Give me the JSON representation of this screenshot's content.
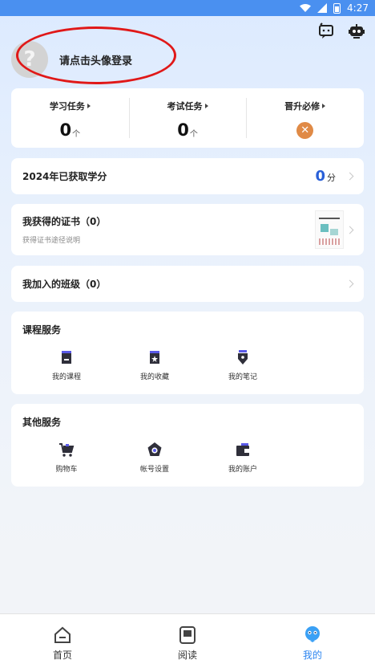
{
  "status_bar": {
    "time": "4:27"
  },
  "header": {
    "icons": [
      "chat-bubble-icon",
      "robot-icon"
    ]
  },
  "profile": {
    "avatar_glyph": "?",
    "login_prompt": "请点击头像登录"
  },
  "tasks": [
    {
      "title": "学习任务",
      "count": "0",
      "unit": "个"
    },
    {
      "title": "考试任务",
      "count": "0",
      "unit": "个"
    },
    {
      "title": "晋升必修",
      "status_glyph": "✕"
    }
  ],
  "credits": {
    "title": "2024年已获取学分",
    "value": "0",
    "unit": "分"
  },
  "certificates": {
    "title": "我获得的证书（0）",
    "subtitle": "获得证书途径说明"
  },
  "classes": {
    "title": "我加入的班级（0）"
  },
  "course_services": {
    "title": "课程服务",
    "items": [
      {
        "label": "我的课程",
        "icon": "course-book-icon"
      },
      {
        "label": "我的收藏",
        "icon": "favorites-star-icon"
      },
      {
        "label": "我的笔记",
        "icon": "notes-pen-icon"
      }
    ]
  },
  "other_services": {
    "title": "其他服务",
    "items": [
      {
        "label": "购物车",
        "icon": "shopping-cart-icon"
      },
      {
        "label": "帐号设置",
        "icon": "account-settings-icon"
      },
      {
        "label": "我的账户",
        "icon": "wallet-icon"
      }
    ]
  },
  "tabbar": {
    "tabs": [
      {
        "label": "首页",
        "icon": "home-icon",
        "active": false
      },
      {
        "label": "阅读",
        "icon": "reading-icon",
        "active": false
      },
      {
        "label": "我的",
        "icon": "mine-mascot-icon",
        "active": true
      }
    ]
  },
  "colors": {
    "accent": "#2e86f0",
    "credit_value": "#2a60d8",
    "status_orange": "#e08a46",
    "annotation_red": "#e01818",
    "icon_dark": "#2f2f3a",
    "icon_accent": "#5a5ae8"
  }
}
